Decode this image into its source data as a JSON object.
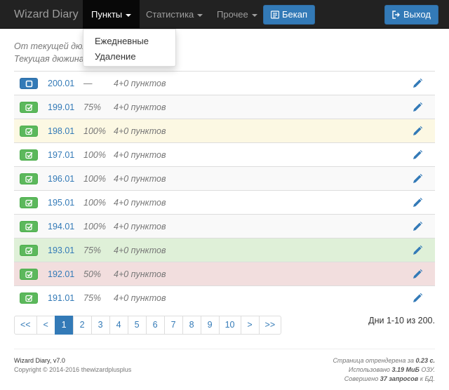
{
  "navbar": {
    "brand": "Wizard Diary",
    "items": [
      {
        "label": "Пункты"
      },
      {
        "label": "Статистика"
      },
      {
        "label": "Прочее"
      }
    ],
    "backup_label": "Бекап",
    "logout_label": "Выход"
  },
  "dropdown": {
    "items": [
      "Ежедневные",
      "Удаление"
    ]
  },
  "info": {
    "line1": "От текущей дюжины",
    "line2": "Текущая дюжина"
  },
  "rows": [
    {
      "num": "200.01",
      "pct": "—",
      "points": "4+0 пунктов",
      "status": "current"
    },
    {
      "num": "199.01",
      "pct": "75%",
      "points": "4+0 пунктов",
      "status": "done"
    },
    {
      "num": "198.01",
      "pct": "100%",
      "points": "4+0 пунктов",
      "status": "done"
    },
    {
      "num": "197.01",
      "pct": "100%",
      "points": "4+0 пунктов",
      "status": "done"
    },
    {
      "num": "196.01",
      "pct": "100%",
      "points": "4+0 пунктов",
      "status": "done"
    },
    {
      "num": "195.01",
      "pct": "100%",
      "points": "4+0 пунктов",
      "status": "done"
    },
    {
      "num": "194.01",
      "pct": "100%",
      "points": "4+0 пунктов",
      "status": "done"
    },
    {
      "num": "193.01",
      "pct": "75%",
      "points": "4+0 пунктов",
      "status": "done"
    },
    {
      "num": "192.01",
      "pct": "50%",
      "points": "4+0 пунктов",
      "status": "done"
    },
    {
      "num": "191.01",
      "pct": "75%",
      "points": "4+0 пунктов",
      "status": "done"
    }
  ],
  "pagination": {
    "first": "<<",
    "prev": "<",
    "pages": [
      "1",
      "2",
      "3",
      "4",
      "5",
      "6",
      "7",
      "8",
      "9",
      "10"
    ],
    "active_page": "1",
    "next": ">",
    "last": ">>"
  },
  "days_summary": "Дни 1-10 из 200.",
  "footer": {
    "app_version": "Wizard Diary, v7.0",
    "copyright": "Copyright © 2014-2016 thewizardplusplus",
    "render_prefix": "Страница отрендерена за ",
    "render_time": "0.23 с.",
    "memory_prefix": "Использовано ",
    "memory": "3.19 МиБ",
    "memory_suffix": " ОЗУ.",
    "queries_prefix": "Совершено ",
    "queries": "37 запросов",
    "queries_suffix": " к БД."
  },
  "colors": {
    "primary": "#337ab7",
    "success": "#5cb85c",
    "warning_row": "#fcf8e3",
    "success_row": "#dff0d8",
    "danger_row": "#f2dede",
    "navbar": "#222222"
  }
}
